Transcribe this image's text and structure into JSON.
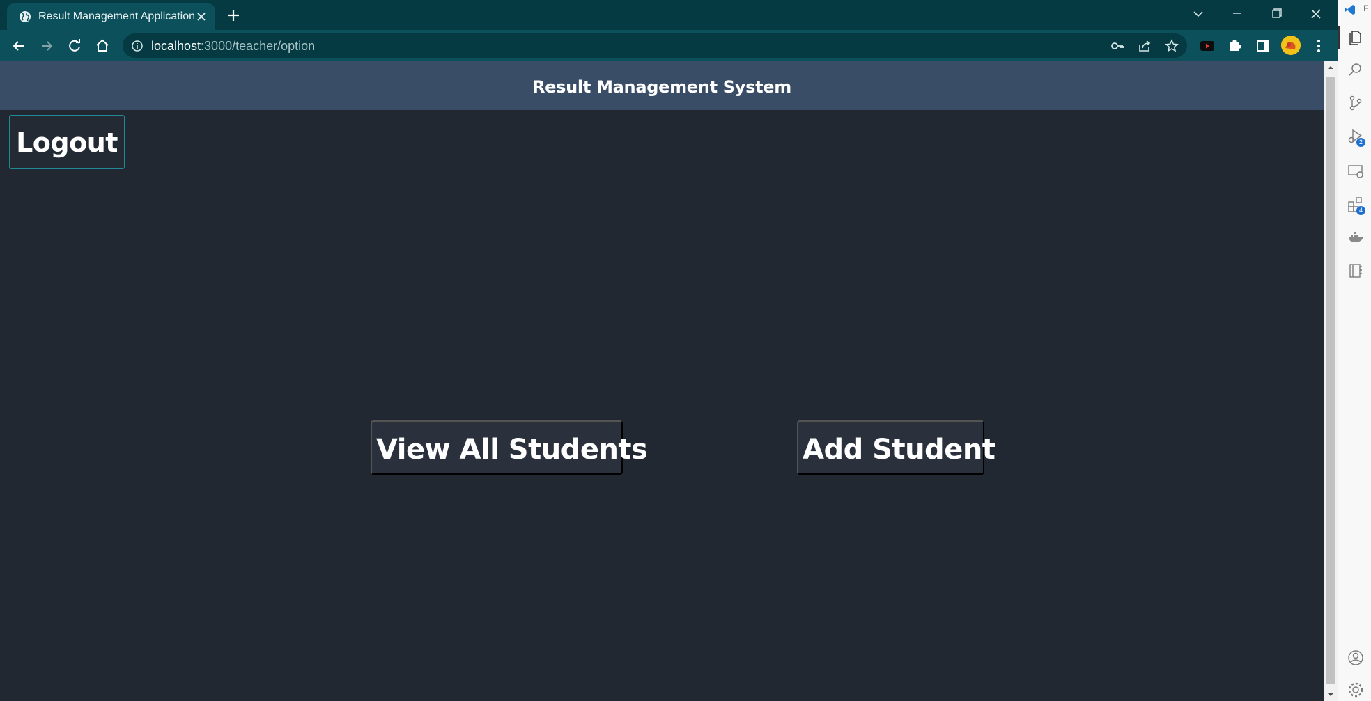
{
  "browser": {
    "tab_title": "Result Management Application",
    "url_host": "localhost",
    "url_path": ":3000/teacher/option",
    "icons": {
      "favicon": "globe-icon",
      "tab_close": "close-icon",
      "new_tab": "plus-icon",
      "back": "arrow-left-icon",
      "forward": "arrow-right-icon",
      "reload": "reload-icon",
      "home": "home-icon",
      "site_info": "info-icon",
      "passwords": "key-icon",
      "share": "share-icon",
      "bookmark": "star-icon",
      "youtube": "youtube-icon",
      "extensions": "puzzle-icon",
      "side_panel": "side-panel-icon",
      "menu": "kebab-menu-icon"
    },
    "colors": {
      "frame": "#063a43",
      "toolbar": "#0b505a"
    }
  },
  "app": {
    "header_title": "Result Management System",
    "logout_label": "Logout",
    "view_all_label": "View All Students",
    "add_student_label": "Add Student",
    "colors": {
      "background": "#222831",
      "header": "#394e66",
      "button": "#2a313c",
      "logout_border": "#1f8a95"
    }
  },
  "activity_bar": {
    "title_letter": "F",
    "run_debug_badge": "2",
    "extensions_badge": "4",
    "icons": [
      "explorer-icon",
      "search-icon",
      "source-control-icon",
      "run-debug-icon",
      "remote-explorer-icon",
      "extensions-icon",
      "docker-icon",
      "notebook-icon",
      "account-icon",
      "settings-gear-icon"
    ]
  }
}
